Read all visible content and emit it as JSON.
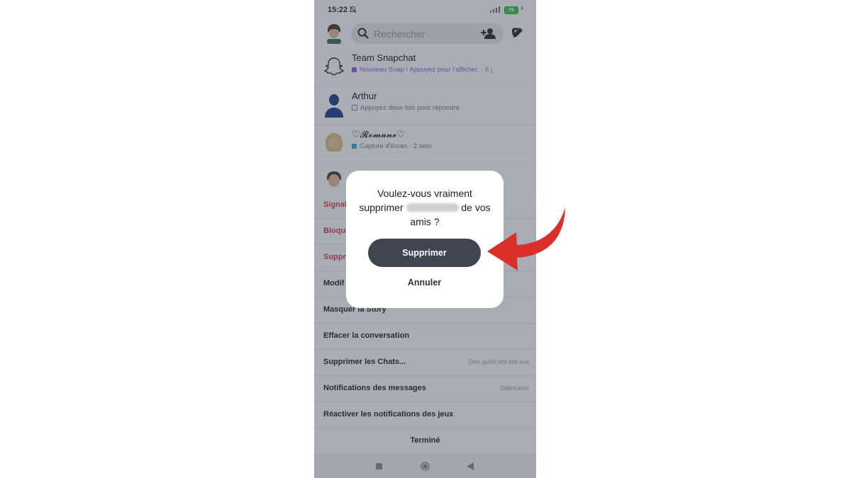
{
  "status_bar": {
    "time": "15:22",
    "battery": "76"
  },
  "header": {
    "search_placeholder": "Rechercher"
  },
  "chats": [
    {
      "name": "Team Snapchat",
      "subtitle": "Nouveau Snap ! Appuyez pour l'afficher.",
      "time": "· 6 j",
      "marker_color": "#9b59d0"
    },
    {
      "name": "Arthur",
      "subtitle": "Appuyez deux fois pour répondre",
      "time": "",
      "marker_color": "#9b59d0"
    },
    {
      "name": "♡𝓡𝓸𝓶𝓪𝓷𝓮♡",
      "subtitle": "Capture d'écran",
      "time": "· 2 sem.",
      "marker_color": "#3aa0e0"
    }
  ],
  "sheet": {
    "options": [
      {
        "label": "Signal",
        "value": ""
      },
      {
        "label": "Bloque",
        "value": ""
      },
      {
        "label": "Suppr",
        "value": ""
      },
      {
        "label": "Modif",
        "value": ""
      },
      {
        "label": "Masquer la Story",
        "value": ""
      },
      {
        "label": "Effacer la conversation",
        "value": ""
      },
      {
        "label": "Supprimer les Chats...",
        "value": "Dès qu'ils ont été vus"
      },
      {
        "label": "Notifications des messages",
        "value": "Silencieux"
      },
      {
        "label": "Réactiver les notifications des jeux",
        "value": ""
      }
    ],
    "done_label": "Terminé"
  },
  "dialog": {
    "line1": "Voulez-vous vraiment",
    "line2_before": "supprimer",
    "line2_after": "de vos",
    "line3": "amis ?",
    "confirm_label": "Supprimer",
    "cancel_label": "Annuler"
  },
  "colors": {
    "danger": "#e0344a",
    "arrow": "#d9302a",
    "primary_button": "#3f4650"
  }
}
